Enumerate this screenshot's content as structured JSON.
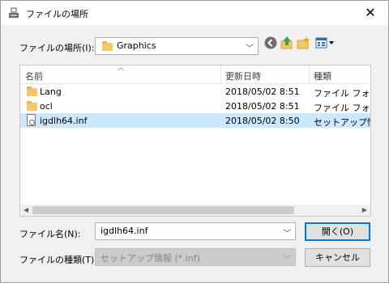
{
  "window": {
    "title": "ファイルの場所"
  },
  "location": {
    "label": "ファイルの場所(I):",
    "value": "Graphics"
  },
  "toolbar": {
    "icons": [
      "back-icon",
      "up-folder-icon",
      "new-folder-icon",
      "view-menu-icon"
    ]
  },
  "file_list": {
    "columns": [
      "名前",
      "更新日時",
      "種類"
    ],
    "rows": [
      {
        "name": "Lang",
        "date": "2018/05/02 8:51",
        "type": "ファイル フォルダー",
        "icon": "folder-icon",
        "selected": false
      },
      {
        "name": "ocl",
        "date": "2018/05/02 8:51",
        "type": "ファイル フォルダー",
        "icon": "folder-icon",
        "selected": false
      },
      {
        "name": "igdlh64.inf",
        "date": "2018/05/02 8:50",
        "type": "セットアップ情報",
        "icon": "setup-file-icon",
        "selected": true
      }
    ]
  },
  "filename": {
    "label": "ファイル名(N):",
    "value": "igdlh64.inf"
  },
  "filetype": {
    "label": "ファイルの種類(T):",
    "value": "セットアップ情報 (*.inf)"
  },
  "buttons": {
    "open": "開く(O)",
    "cancel": "キャンセル"
  },
  "colors": {
    "selection": "#cce8ff",
    "default_button_border": "#0078d7",
    "folder": "#f4c86a"
  }
}
